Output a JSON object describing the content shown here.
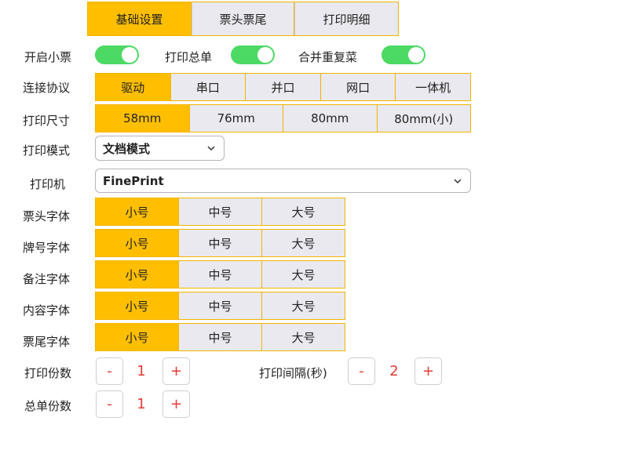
{
  "tabs": [
    "基础设置",
    "票头票尾",
    "打印明细"
  ],
  "toggles": {
    "open_ticket": {
      "label": "开启小票",
      "on": true
    },
    "print_summary": {
      "label": "打印总单",
      "on": true
    },
    "merge_dishes": {
      "label": "合并重复菜",
      "on": true
    }
  },
  "protocol": {
    "label": "连接协议",
    "options": [
      "驱动",
      "串口",
      "并口",
      "网口",
      "一体机"
    ],
    "selected": "驱动"
  },
  "paper_size": {
    "label": "打印尺寸",
    "options": [
      "58mm",
      "76mm",
      "80mm",
      "80mm(小)"
    ],
    "selected": "58mm"
  },
  "print_mode": {
    "label": "打印模式",
    "value": "文档模式"
  },
  "printer": {
    "label": "打印机",
    "value": "FinePrint"
  },
  "font_options": [
    "小号",
    "中号",
    "大号"
  ],
  "fonts": [
    {
      "label": "票头字体",
      "selected": "小号"
    },
    {
      "label": "牌号字体",
      "selected": "小号"
    },
    {
      "label": "备注字体",
      "selected": "小号"
    },
    {
      "label": "内容字体",
      "selected": "小号"
    },
    {
      "label": "票尾字体",
      "selected": "小号"
    }
  ],
  "copies": {
    "label": "打印份数",
    "value": "1",
    "minus": "-",
    "plus": "+"
  },
  "interval": {
    "label": "打印间隔(秒)",
    "value": "2",
    "minus": "-",
    "plus": "+"
  },
  "summary_copies": {
    "label": "总单份数",
    "value": "1",
    "minus": "-",
    "plus": "+"
  },
  "colors": {
    "accent": "#ffbf00",
    "toggle_on": "#4cd964",
    "stepper": "#e53935",
    "inactive": "#e9e9ef"
  }
}
